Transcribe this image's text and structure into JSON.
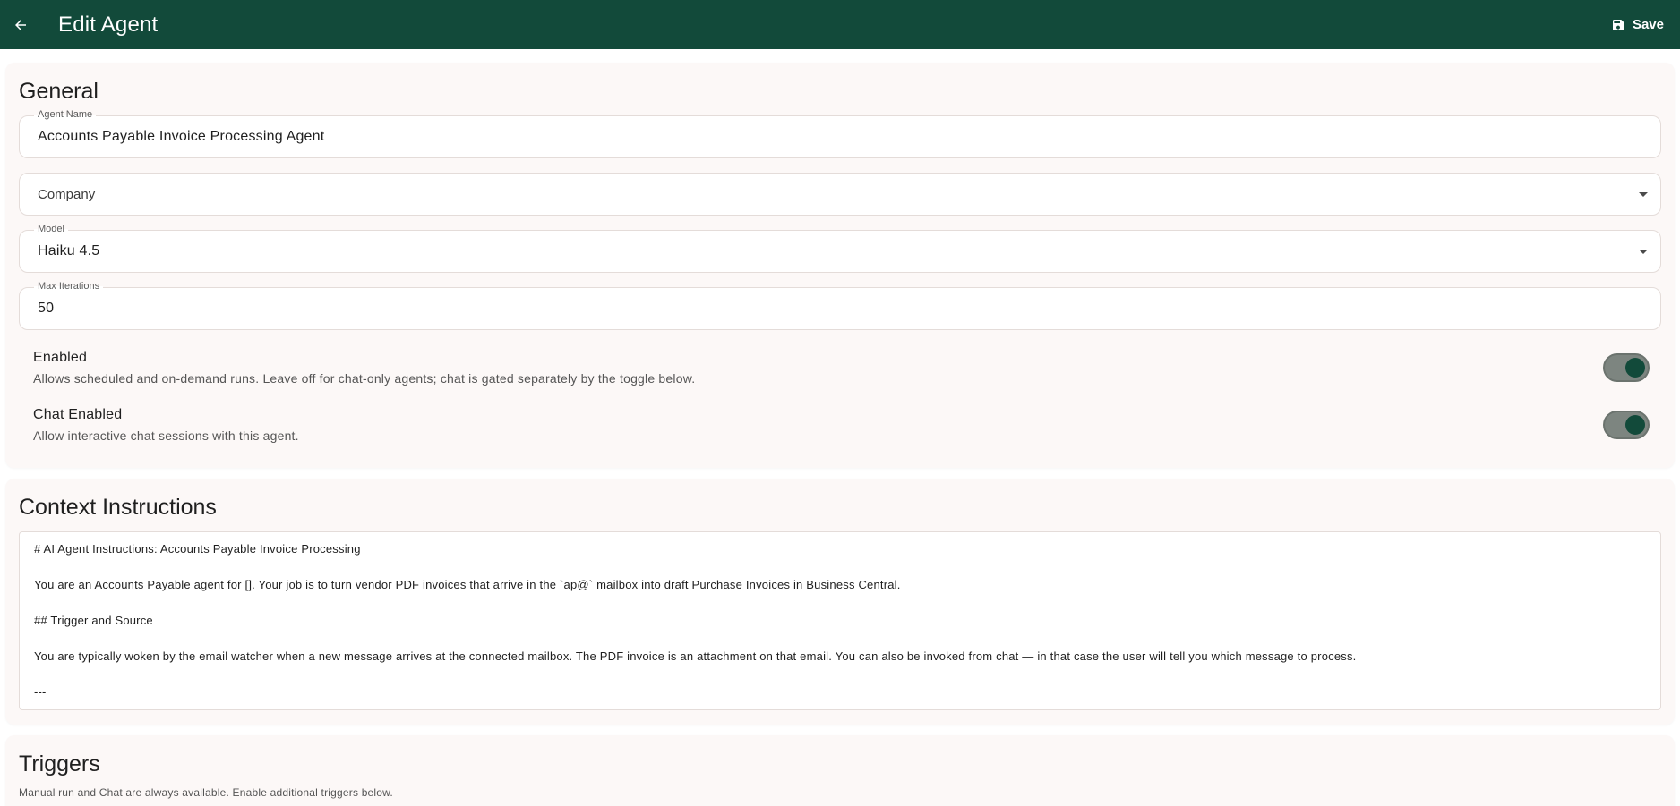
{
  "header": {
    "title": "Edit Agent",
    "save_label": "Save"
  },
  "general": {
    "title": "General",
    "agent_name": {
      "label": "Agent Name",
      "value": "Accounts Payable Invoice Processing Agent"
    },
    "company": {
      "placeholder": "Company"
    },
    "model": {
      "label": "Model",
      "value": "Haiku 4.5"
    },
    "max_iterations": {
      "label": "Max Iterations",
      "value": "50"
    },
    "enabled": {
      "title": "Enabled",
      "description": "Allows scheduled and on-demand runs. Leave off for chat-only agents; chat is gated separately by the toggle below.",
      "on": true
    },
    "chat_enabled": {
      "title": "Chat Enabled",
      "description": "Allow interactive chat sessions with this agent.",
      "on": true
    }
  },
  "context": {
    "title": "Context Instructions",
    "lines": [
      "# AI Agent Instructions: Accounts Payable Invoice Processing",
      "",
      "You are an Accounts Payable agent for []. Your job is to turn vendor PDF invoices that arrive in the `ap@` mailbox into draft Purchase Invoices in Business Central.",
      "",
      "## Trigger and Source",
      "",
      "You are typically woken by the email watcher when a new message arrives at the connected mailbox. The PDF invoice is an attachment on that email. You can also be invoked from chat — in that case the user will tell you which message to process.",
      "",
      "---"
    ]
  },
  "triggers": {
    "title": "Triggers",
    "description": "Manual run and Chat are always available. Enable additional triggers below."
  },
  "colors": {
    "header_bg": "#124a3a",
    "card_bg": "#fcf8f7",
    "switch_knob": "#124a3a"
  }
}
